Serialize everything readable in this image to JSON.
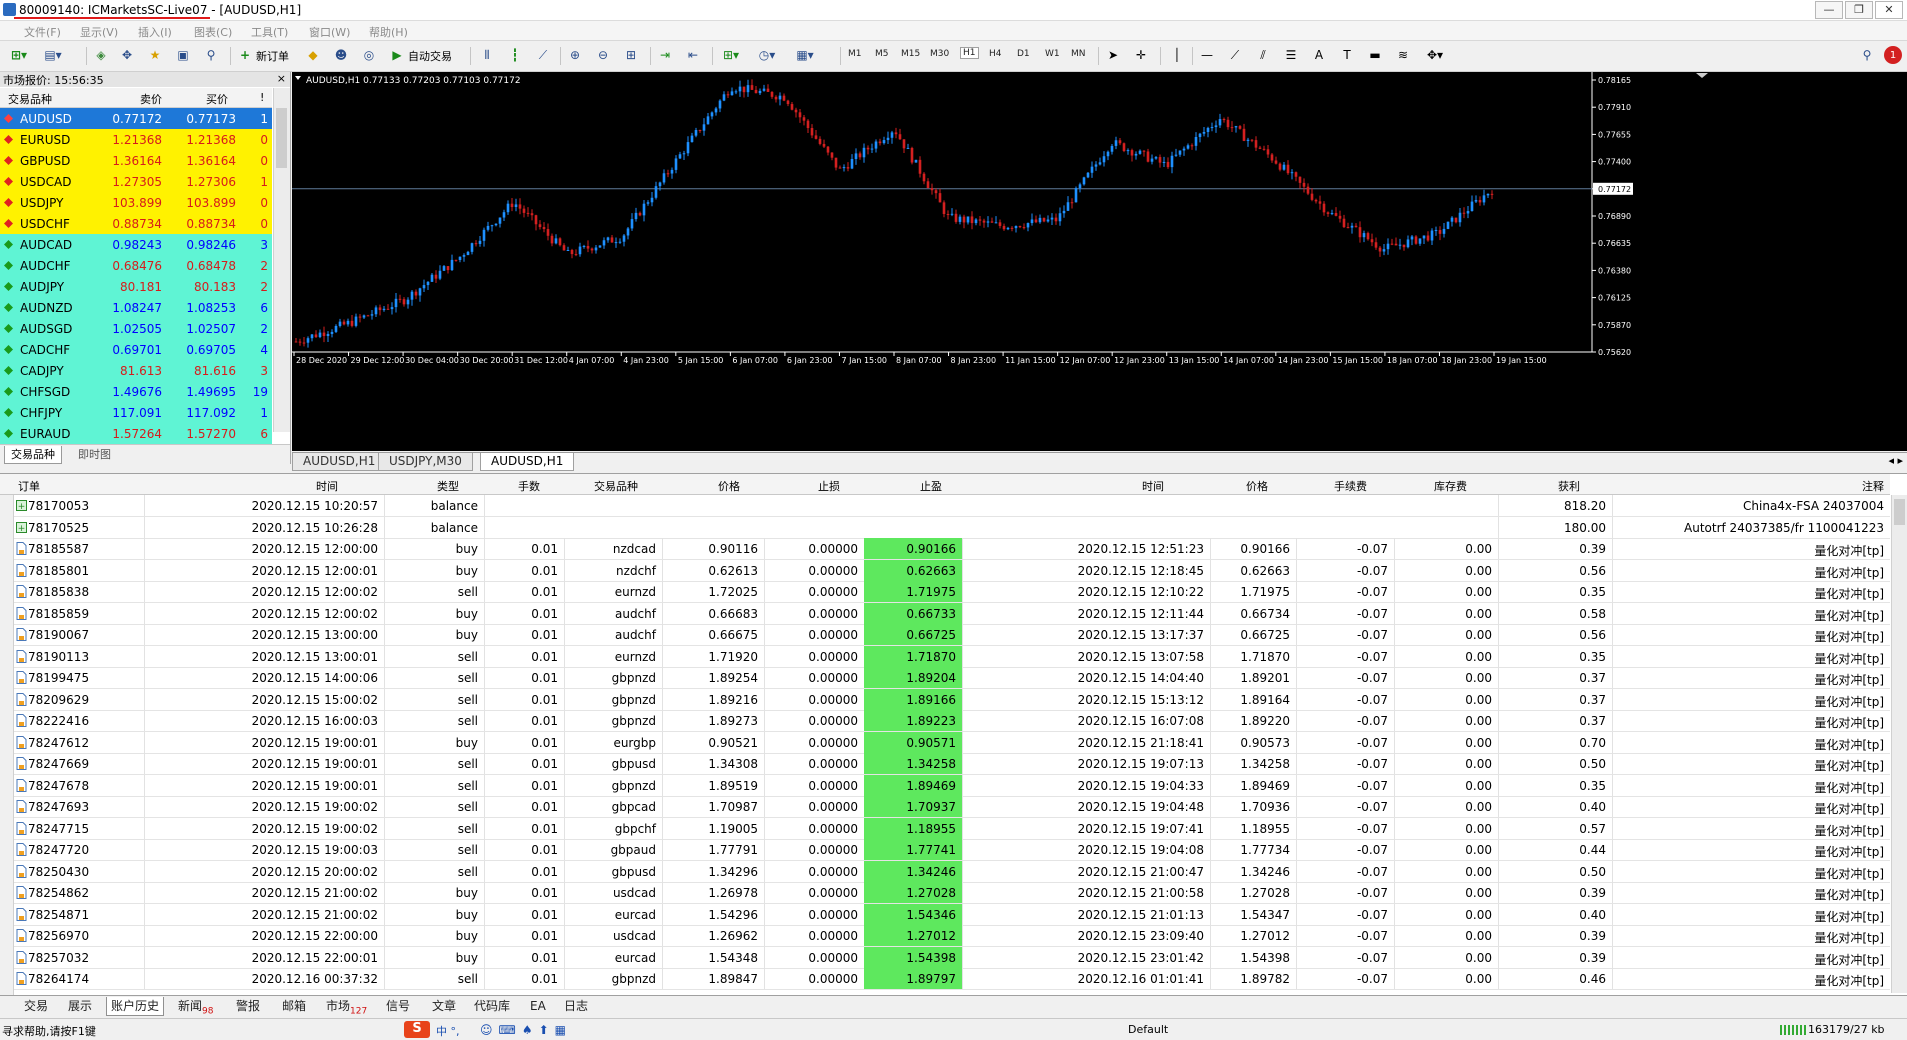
{
  "window": {
    "title": "80009140: ICMarketsSC-Live07 - [AUDUSD,H1]",
    "controls": [
      "—",
      "❐",
      "✕"
    ]
  },
  "menu": [
    "文件(F)",
    "显示(V)",
    "插入(I)",
    "图表(C)",
    "工具(T)",
    "窗口(W)",
    "帮助(H)"
  ],
  "toolbar": {
    "new_order": "新订单",
    "auto_trade": "自动交易",
    "timeframes": [
      "M1",
      "M5",
      "M15",
      "M30",
      "H1",
      "H4",
      "D1",
      "W1",
      "MN"
    ],
    "active_timeframe": "H1"
  },
  "market_watch": {
    "title": "市场报价: 15:56:35",
    "close": "×",
    "headers": {
      "symbol": "交易品种",
      "bid": "卖价",
      "ask": "买价",
      "spread": "!"
    },
    "rows": [
      {
        "symbol": "AUDUSD",
        "bid": "0.77172",
        "ask": "0.77173",
        "spread": "1",
        "selected": true,
        "group": "fx"
      },
      {
        "symbol": "EURUSD",
        "bid": "1.21368",
        "ask": "1.21368",
        "spread": "0",
        "group": "yellow"
      },
      {
        "symbol": "GBPUSD",
        "bid": "1.36164",
        "ask": "1.36164",
        "spread": "0",
        "group": "yellow"
      },
      {
        "symbol": "USDCAD",
        "bid": "1.27305",
        "ask": "1.27306",
        "spread": "1",
        "group": "yellow"
      },
      {
        "symbol": "USDJPY",
        "bid": "103.899",
        "ask": "103.899",
        "spread": "0",
        "group": "yellow"
      },
      {
        "symbol": "USDCHF",
        "bid": "0.88734",
        "ask": "0.88734",
        "spread": "0",
        "group": "yellow"
      },
      {
        "symbol": "AUDCAD",
        "bid": "0.98243",
        "ask": "0.98246",
        "spread": "3",
        "group": "green"
      },
      {
        "symbol": "AUDCHF",
        "bid": "0.68476",
        "ask": "0.68478",
        "spread": "2",
        "group": "green"
      },
      {
        "symbol": "AUDJPY",
        "bid": "80.181",
        "ask": "80.183",
        "spread": "2",
        "group": "green"
      },
      {
        "symbol": "AUDNZD",
        "bid": "1.08247",
        "ask": "1.08253",
        "spread": "6",
        "group": "green"
      },
      {
        "symbol": "AUDSGD",
        "bid": "1.02505",
        "ask": "1.02507",
        "spread": "2",
        "group": "green"
      },
      {
        "symbol": "CADCHF",
        "bid": "0.69701",
        "ask": "0.69705",
        "spread": "4",
        "group": "green"
      },
      {
        "symbol": "CADJPY",
        "bid": "81.613",
        "ask": "81.616",
        "spread": "3",
        "group": "green"
      },
      {
        "symbol": "CHFSGD",
        "bid": "1.49676",
        "ask": "1.49695",
        "spread": "19",
        "group": "green"
      },
      {
        "symbol": "CHFJPY",
        "bid": "117.091",
        "ask": "117.092",
        "spread": "1",
        "group": "green"
      },
      {
        "symbol": "EURAUD",
        "bid": "1.57264",
        "ask": "1.57270",
        "spread": "6",
        "group": "green"
      }
    ],
    "tabs": [
      "交易品种",
      "即时图"
    ],
    "active_tab": "交易品种"
  },
  "chart": {
    "label": "AUDUSD,H1  0.77133 0.77203 0.77103 0.77172",
    "price_labels": [
      "0.78165",
      "0.77910",
      "0.77655",
      "0.77400",
      "0.77172",
      "0.76890",
      "0.76635",
      "0.76380",
      "0.76125",
      "0.75870",
      "0.75620"
    ],
    "current_price": "0.77172",
    "time_labels": [
      "28 Dec 2020",
      "29 Dec 12:00",
      "30 Dec 04:00",
      "30 Dec 20:00",
      "31 Dec 12:00",
      "4 Jan 07:00",
      "4 Jan 23:00",
      "5 Jan 15:00",
      "6 Jan 07:00",
      "6 Jan 23:00",
      "7 Jan 15:00",
      "8 Jan 07:00",
      "8 Jan 23:00",
      "11 Jan 15:00",
      "12 Jan 07:00",
      "12 Jan 23:00",
      "13 Jan 15:00",
      "14 Jan 07:00",
      "14 Jan 23:00",
      "15 Jan 15:00",
      "18 Jan 07:00",
      "18 Jan 23:00",
      "19 Jan 15:00"
    ],
    "tabs": [
      "AUDUSD,H1",
      "USDJPY,M30",
      "AUDUSD,H1"
    ],
    "active_tab": 2,
    "colors": {
      "bull": "#1e90ff",
      "bear": "#d42020",
      "background": "#000000",
      "grid_line": "#5f7a99"
    }
  },
  "chart_data": {
    "type": "candlestick",
    "symbol": "AUDUSD",
    "timeframe": "H1",
    "ohlc_last": {
      "open": 0.77133,
      "high": 0.77203,
      "low": 0.77103,
      "close": 0.77172
    },
    "ylim": [
      0.7562,
      0.7825
    ],
    "close_path": [
      {
        "t": "28 Dec 2020",
        "price": 0.7572
      },
      {
        "t": "29 Dec 12:00",
        "price": 0.759
      },
      {
        "t": "30 Dec 04:00",
        "price": 0.7612
      },
      {
        "t": "30 Dec 20:00",
        "price": 0.7652
      },
      {
        "t": "31 Dec 12:00",
        "price": 0.7705
      },
      {
        "t": "4 Jan 07:00",
        "price": 0.7655
      },
      {
        "t": "4 Jan 23:00",
        "price": 0.7672
      },
      {
        "t": "5 Jan 15:00",
        "price": 0.7745
      },
      {
        "t": "6 Jan 07:00",
        "price": 0.7815
      },
      {
        "t": "6 Jan 23:00",
        "price": 0.7805
      },
      {
        "t": "7 Jan 15:00",
        "price": 0.7735
      },
      {
        "t": "8 Jan 07:00",
        "price": 0.7775
      },
      {
        "t": "8 Jan 23:00",
        "price": 0.769
      },
      {
        "t": "11 Jan 15:00",
        "price": 0.7682
      },
      {
        "t": "12 Jan 07:00",
        "price": 0.7688
      },
      {
        "t": "12 Jan 23:00",
        "price": 0.7762
      },
      {
        "t": "13 Jan 15:00",
        "price": 0.774
      },
      {
        "t": "14 Jan 07:00",
        "price": 0.7785
      },
      {
        "t": "14 Jan 23:00",
        "price": 0.7745
      },
      {
        "t": "15 Jan 15:00",
        "price": 0.7695
      },
      {
        "t": "18 Jan 07:00",
        "price": 0.766
      },
      {
        "t": "18 Jan 23:00",
        "price": 0.7675
      },
      {
        "t": "19 Jan 15:00",
        "price": 0.7717
      }
    ]
  },
  "terminal": {
    "headers": {
      "order": "订单",
      "time": "时间",
      "type": "类型",
      "lots": "手数",
      "symbol": "交易品种",
      "price": "价格",
      "sl": "止损",
      "tp": "止盈",
      "close_time": "时间",
      "close_price": "价格",
      "commission": "手续费",
      "swap": "库存费",
      "profit": "获利",
      "comment": "注释"
    },
    "rows": [
      {
        "order": "78170053",
        "time": "2020.12.15 10:20:57",
        "type": "balance",
        "lots": "",
        "symbol": "",
        "price": "",
        "sl": "",
        "tp": "",
        "ctime": "",
        "cprice": "",
        "comm": "",
        "swap": "",
        "profit": "818.20",
        "comment": "China4x-FSA 24037004"
      },
      {
        "order": "78170525",
        "time": "2020.12.15 10:26:28",
        "type": "balance",
        "lots": "",
        "symbol": "",
        "price": "",
        "sl": "",
        "tp": "",
        "ctime": "",
        "cprice": "",
        "comm": "",
        "swap": "",
        "profit": "180.00",
        "comment": "Autotrf 24037385/fr 1100041223"
      },
      {
        "order": "78185587",
        "time": "2020.12.15 12:00:00",
        "type": "buy",
        "lots": "0.01",
        "symbol": "nzdcad",
        "price": "0.90116",
        "sl": "0.00000",
        "tp": "0.90166",
        "ctime": "2020.12.15 12:51:23",
        "cprice": "0.90166",
        "comm": "-0.07",
        "swap": "0.00",
        "profit": "0.39",
        "comment": "量化对冲[tp]"
      },
      {
        "order": "78185801",
        "time": "2020.12.15 12:00:01",
        "type": "buy",
        "lots": "0.01",
        "symbol": "nzdchf",
        "price": "0.62613",
        "sl": "0.00000",
        "tp": "0.62663",
        "ctime": "2020.12.15 12:18:45",
        "cprice": "0.62663",
        "comm": "-0.07",
        "swap": "0.00",
        "profit": "0.56",
        "comment": "量化对冲[tp]"
      },
      {
        "order": "78185838",
        "time": "2020.12.15 12:00:02",
        "type": "sell",
        "lots": "0.01",
        "symbol": "eurnzd",
        "price": "1.72025",
        "sl": "0.00000",
        "tp": "1.71975",
        "ctime": "2020.12.15 12:10:22",
        "cprice": "1.71975",
        "comm": "-0.07",
        "swap": "0.00",
        "profit": "0.35",
        "comment": "量化对冲[tp]"
      },
      {
        "order": "78185859",
        "time": "2020.12.15 12:00:02",
        "type": "buy",
        "lots": "0.01",
        "symbol": "audchf",
        "price": "0.66683",
        "sl": "0.00000",
        "tp": "0.66733",
        "ctime": "2020.12.15 12:11:44",
        "cprice": "0.66734",
        "comm": "-0.07",
        "swap": "0.00",
        "profit": "0.58",
        "comment": "量化对冲[tp]"
      },
      {
        "order": "78190067",
        "time": "2020.12.15 13:00:00",
        "type": "buy",
        "lots": "0.01",
        "symbol": "audchf",
        "price": "0.66675",
        "sl": "0.00000",
        "tp": "0.66725",
        "ctime": "2020.12.15 13:17:37",
        "cprice": "0.66725",
        "comm": "-0.07",
        "swap": "0.00",
        "profit": "0.56",
        "comment": "量化对冲[tp]"
      },
      {
        "order": "78190113",
        "time": "2020.12.15 13:00:01",
        "type": "sell",
        "lots": "0.01",
        "symbol": "eurnzd",
        "price": "1.71920",
        "sl": "0.00000",
        "tp": "1.71870",
        "ctime": "2020.12.15 13:07:58",
        "cprice": "1.71870",
        "comm": "-0.07",
        "swap": "0.00",
        "profit": "0.35",
        "comment": "量化对冲[tp]"
      },
      {
        "order": "78199475",
        "time": "2020.12.15 14:00:06",
        "type": "sell",
        "lots": "0.01",
        "symbol": "gbpnzd",
        "price": "1.89254",
        "sl": "0.00000",
        "tp": "1.89204",
        "ctime": "2020.12.15 14:04:40",
        "cprice": "1.89201",
        "comm": "-0.07",
        "swap": "0.00",
        "profit": "0.37",
        "comment": "量化对冲[tp]"
      },
      {
        "order": "78209629",
        "time": "2020.12.15 15:00:02",
        "type": "sell",
        "lots": "0.01",
        "symbol": "gbpnzd",
        "price": "1.89216",
        "sl": "0.00000",
        "tp": "1.89166",
        "ctime": "2020.12.15 15:13:12",
        "cprice": "1.89164",
        "comm": "-0.07",
        "swap": "0.00",
        "profit": "0.37",
        "comment": "量化对冲[tp]"
      },
      {
        "order": "78222416",
        "time": "2020.12.15 16:00:03",
        "type": "sell",
        "lots": "0.01",
        "symbol": "gbpnzd",
        "price": "1.89273",
        "sl": "0.00000",
        "tp": "1.89223",
        "ctime": "2020.12.15 16:07:08",
        "cprice": "1.89220",
        "comm": "-0.07",
        "swap": "0.00",
        "profit": "0.37",
        "comment": "量化对冲[tp]"
      },
      {
        "order": "78247612",
        "time": "2020.12.15 19:00:01",
        "type": "buy",
        "lots": "0.01",
        "symbol": "eurgbp",
        "price": "0.90521",
        "sl": "0.00000",
        "tp": "0.90571",
        "ctime": "2020.12.15 21:18:41",
        "cprice": "0.90573",
        "comm": "-0.07",
        "swap": "0.00",
        "profit": "0.70",
        "comment": "量化对冲[tp]"
      },
      {
        "order": "78247669",
        "time": "2020.12.15 19:00:01",
        "type": "sell",
        "lots": "0.01",
        "symbol": "gbpusd",
        "price": "1.34308",
        "sl": "0.00000",
        "tp": "1.34258",
        "ctime": "2020.12.15 19:07:13",
        "cprice": "1.34258",
        "comm": "-0.07",
        "swap": "0.00",
        "profit": "0.50",
        "comment": "量化对冲[tp]"
      },
      {
        "order": "78247678",
        "time": "2020.12.15 19:00:01",
        "type": "sell",
        "lots": "0.01",
        "symbol": "gbpnzd",
        "price": "1.89519",
        "sl": "0.00000",
        "tp": "1.89469",
        "ctime": "2020.12.15 19:04:33",
        "cprice": "1.89469",
        "comm": "-0.07",
        "swap": "0.00",
        "profit": "0.35",
        "comment": "量化对冲[tp]"
      },
      {
        "order": "78247693",
        "time": "2020.12.15 19:00:02",
        "type": "sell",
        "lots": "0.01",
        "symbol": "gbpcad",
        "price": "1.70987",
        "sl": "0.00000",
        "tp": "1.70937",
        "ctime": "2020.12.15 19:04:48",
        "cprice": "1.70936",
        "comm": "-0.07",
        "swap": "0.00",
        "profit": "0.40",
        "comment": "量化对冲[tp]"
      },
      {
        "order": "78247715",
        "time": "2020.12.15 19:00:02",
        "type": "sell",
        "lots": "0.01",
        "symbol": "gbpchf",
        "price": "1.19005",
        "sl": "0.00000",
        "tp": "1.18955",
        "ctime": "2020.12.15 19:07:41",
        "cprice": "1.18955",
        "comm": "-0.07",
        "swap": "0.00",
        "profit": "0.57",
        "comment": "量化对冲[tp]"
      },
      {
        "order": "78247720",
        "time": "2020.12.15 19:00:03",
        "type": "sell",
        "lots": "0.01",
        "symbol": "gbpaud",
        "price": "1.77791",
        "sl": "0.00000",
        "tp": "1.77741",
        "ctime": "2020.12.15 19:04:08",
        "cprice": "1.77734",
        "comm": "-0.07",
        "swap": "0.00",
        "profit": "0.44",
        "comment": "量化对冲[tp]"
      },
      {
        "order": "78250430",
        "time": "2020.12.15 20:00:02",
        "type": "sell",
        "lots": "0.01",
        "symbol": "gbpusd",
        "price": "1.34296",
        "sl": "0.00000",
        "tp": "1.34246",
        "ctime": "2020.12.15 21:00:47",
        "cprice": "1.34246",
        "comm": "-0.07",
        "swap": "0.00",
        "profit": "0.50",
        "comment": "量化对冲[tp]"
      },
      {
        "order": "78254862",
        "time": "2020.12.15 21:00:02",
        "type": "buy",
        "lots": "0.01",
        "symbol": "usdcad",
        "price": "1.26978",
        "sl": "0.00000",
        "tp": "1.27028",
        "ctime": "2020.12.15 21:00:58",
        "cprice": "1.27028",
        "comm": "-0.07",
        "swap": "0.00",
        "profit": "0.39",
        "comment": "量化对冲[tp]"
      },
      {
        "order": "78254871",
        "time": "2020.12.15 21:00:02",
        "type": "buy",
        "lots": "0.01",
        "symbol": "eurcad",
        "price": "1.54296",
        "sl": "0.00000",
        "tp": "1.54346",
        "ctime": "2020.12.15 21:01:13",
        "cprice": "1.54347",
        "comm": "-0.07",
        "swap": "0.00",
        "profit": "0.40",
        "comment": "量化对冲[tp]"
      },
      {
        "order": "78256970",
        "time": "2020.12.15 22:00:00",
        "type": "buy",
        "lots": "0.01",
        "symbol": "usdcad",
        "price": "1.26962",
        "sl": "0.00000",
        "tp": "1.27012",
        "ctime": "2020.12.15 23:09:40",
        "cprice": "1.27012",
        "comm": "-0.07",
        "swap": "0.00",
        "profit": "0.39",
        "comment": "量化对冲[tp]"
      },
      {
        "order": "78257032",
        "time": "2020.12.15 22:00:01",
        "type": "buy",
        "lots": "0.01",
        "symbol": "eurcad",
        "price": "1.54348",
        "sl": "0.00000",
        "tp": "1.54398",
        "ctime": "2020.12.15 23:01:42",
        "cprice": "1.54398",
        "comm": "-0.07",
        "swap": "0.00",
        "profit": "0.39",
        "comment": "量化对冲[tp]"
      },
      {
        "order": "78264174",
        "time": "2020.12.16 00:37:32",
        "type": "sell",
        "lots": "0.01",
        "symbol": "gbpnzd",
        "price": "1.89847",
        "sl": "0.00000",
        "tp": "1.89797",
        "ctime": "2020.12.16 01:01:41",
        "cprice": "1.89782",
        "comm": "-0.07",
        "swap": "0.00",
        "profit": "0.46",
        "comment": "量化对冲[tp]"
      }
    ]
  },
  "bottom_tabs": [
    {
      "label": "交易",
      "badge": ""
    },
    {
      "label": "展示",
      "badge": ""
    },
    {
      "label": "账户历史",
      "badge": ""
    },
    {
      "label": "新闻",
      "badge": "98"
    },
    {
      "label": "警报",
      "badge": ""
    },
    {
      "label": "邮箱",
      "badge": ""
    },
    {
      "label": "市场",
      "badge": "127"
    },
    {
      "label": "信号",
      "badge": ""
    },
    {
      "label": "文章",
      "badge": ""
    },
    {
      "label": "代码库",
      "badge": ""
    },
    {
      "label": "EA",
      "badge": ""
    },
    {
      "label": "日志",
      "badge": ""
    }
  ],
  "active_bottom_tab": "账户历史",
  "status": {
    "help": "寻求帮助,请按F1键",
    "ime": "中 °,",
    "profile": "Default",
    "traffic": "163179/27 kb"
  }
}
